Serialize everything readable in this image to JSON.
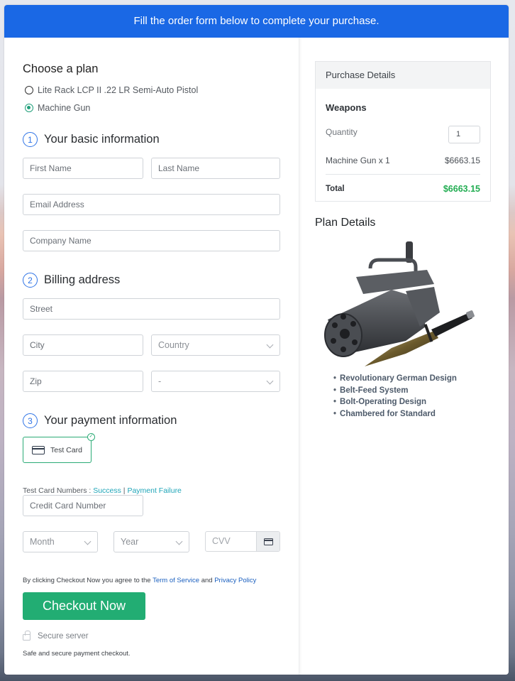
{
  "banner": {
    "text": "Fill the order form below to complete your purchase."
  },
  "plan": {
    "title": "Choose a plan",
    "options": [
      {
        "label": "Lite Rack LCP II .22 LR Semi-Auto Pistol",
        "selected": false
      },
      {
        "label": "Machine Gun",
        "selected": true
      }
    ]
  },
  "basic_info": {
    "step": "1",
    "title": "Your basic information",
    "first_name_placeholder": "First Name",
    "last_name_placeholder": "Last Name",
    "email_placeholder": "Email Address",
    "company_placeholder": "Company Name"
  },
  "billing": {
    "step": "2",
    "title": "Billing address",
    "street_placeholder": "Street",
    "city_placeholder": "City",
    "country_placeholder": "Country",
    "zip_placeholder": "Zip",
    "state_placeholder": "-"
  },
  "payment": {
    "step": "3",
    "title": "Your payment information",
    "method_label": "Test Card",
    "test_numbers_label": "Test Card Numbers : ",
    "success_link": "Success",
    "separator": " | ",
    "failure_link": "Payment Failure",
    "card_number_placeholder": "Credit Card Number",
    "month_placeholder": "Month",
    "year_placeholder": "Year",
    "cvv_placeholder": "CVV"
  },
  "agreement": {
    "prefix": "By clicking Checkout Now you agree to the ",
    "terms_link": "Term of Service",
    "middle": " and ",
    "privacy_link": "Privacy Policy"
  },
  "checkout": {
    "button_label": "Checkout Now",
    "secure_label": "Secure server",
    "safe_text": "Safe and secure payment checkout."
  },
  "purchase_details": {
    "title": "Purchase Details",
    "category": "Weapons",
    "quantity_label": "Quantity",
    "quantity_value": "1",
    "line_item": "Machine Gun x 1",
    "line_price": "$6663.15",
    "total_label": "Total",
    "total_price": "$6663.15"
  },
  "plan_details": {
    "title": "Plan Details",
    "image_alt": "Minigun and combat knife",
    "features": [
      "Revolutionary German Design",
      "Belt-Feed System",
      "Bolt-Operating Design",
      "Chambered for Standard"
    ]
  },
  "colors": {
    "banner": "#1a68e5",
    "accent_green": "#22ad73",
    "total_green": "#22ad52",
    "step_blue": "#2e73e6",
    "link_teal": "#1fa5b8"
  }
}
